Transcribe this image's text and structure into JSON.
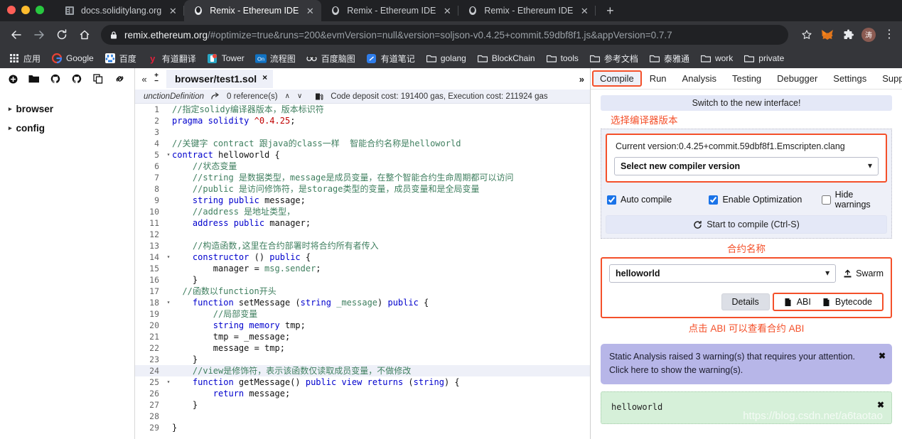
{
  "browser": {
    "tabs": [
      {
        "title": "docs.soliditylang.org",
        "favicon": "book-icon",
        "active": false
      },
      {
        "title": "Remix - Ethereum IDE",
        "favicon": "remix-logo-icon",
        "active": true
      },
      {
        "title": "Remix - Ethereum IDE",
        "favicon": "remix-logo-icon",
        "active": false
      },
      {
        "title": "Remix - Ethereum IDE",
        "favicon": "remix-logo-icon",
        "active": false
      }
    ],
    "new_tab_label": "+",
    "nav": {
      "back": "back-icon",
      "forward": "forward-icon",
      "reload": "reload-icon",
      "home": "home-icon"
    },
    "omnibox": {
      "lock": "lock-icon",
      "domain": "remix.ethereum.org",
      "path": "/#optimize=true&runs=200&evmVersion=null&version=soljson-v0.4.25+commit.59dbf8f1.js&appVersion=0.7.7",
      "star": "star-icon"
    },
    "extensions": [
      {
        "name": "metamask-icon",
        "glyph": "🦊"
      },
      {
        "name": "puzzle-extension-icon",
        "glyph": "🧩"
      },
      {
        "name": "profile-avatar",
        "glyph": "涛"
      },
      {
        "name": "menu-kebab-icon",
        "glyph": "⋮"
      }
    ],
    "bookmarks": [
      {
        "label": "应用",
        "icon": "apps-grid-icon"
      },
      {
        "label": "Google",
        "icon": "google-icon"
      },
      {
        "label": "百度",
        "icon": "baidu-icon"
      },
      {
        "label": "有道翻译",
        "icon": "youdao-translate-icon"
      },
      {
        "label": "Tower",
        "icon": "tower-icon"
      },
      {
        "label": "流程图",
        "icon": "on-flowchart-icon"
      },
      {
        "label": "百度脑图",
        "icon": "baidu-naotu-icon"
      },
      {
        "label": "有道笔记",
        "icon": "youdao-note-icon"
      },
      {
        "label": "golang",
        "icon": "folder-icon"
      },
      {
        "label": "BlockChain",
        "icon": "folder-icon"
      },
      {
        "label": "tools",
        "icon": "folder-icon"
      },
      {
        "label": "参考文档",
        "icon": "folder-icon"
      },
      {
        "label": "泰雅通",
        "icon": "folder-icon"
      },
      {
        "label": "work",
        "icon": "folder-icon"
      },
      {
        "label": "private",
        "icon": "folder-icon"
      }
    ]
  },
  "file_panel": {
    "toolbar_icons": [
      "create-new-file-icon",
      "open-folder-icon",
      "connect-github-icon",
      "publish-gist-icon",
      "copy-files-icon",
      "link-icon"
    ],
    "nodes": [
      {
        "label": "browser",
        "caret": "▸"
      },
      {
        "label": "config",
        "caret": "▸"
      }
    ]
  },
  "editor": {
    "collapse_icon": "collapse-left-icon",
    "zoom_in": "+",
    "zoom_out": "−",
    "tab_label": "browser/test1.sol",
    "tab_close": "×",
    "expand_icon": "»",
    "info": {
      "symbol": "unctionDefinition",
      "goto_icon": "goto-reference-icon",
      "references": "0 reference(s)",
      "up": "∧",
      "down": "∨",
      "gas_icon": "gas-pump-icon",
      "gas_text": "Code deposit cost: 191400 gas, Execution cost: 211924 gas"
    },
    "lines": [
      {
        "n": 1,
        "fold": "",
        "indent": 0,
        "hl": false,
        "tokens": [
          {
            "t": "//指定solidy编译器版本，版本标识符",
            "c": "cmt"
          }
        ]
      },
      {
        "n": 2,
        "fold": "",
        "indent": 0,
        "hl": false,
        "tokens": [
          {
            "t": "pragma",
            "c": "kw"
          },
          {
            "t": " ",
            "c": "src"
          },
          {
            "t": "solidity",
            "c": "kw"
          },
          {
            "t": " ",
            "c": "src"
          },
          {
            "t": "^0.4.25",
            "c": "num"
          },
          {
            "t": ";",
            "c": "src"
          }
        ]
      },
      {
        "n": 3,
        "fold": "",
        "indent": 0,
        "hl": false,
        "tokens": []
      },
      {
        "n": 4,
        "fold": "",
        "indent": 0,
        "hl": false,
        "tokens": [
          {
            "t": "//关键字 contract 跟java的class一样  智能合约名称是helloworld",
            "c": "cmt"
          }
        ]
      },
      {
        "n": 5,
        "fold": "▾",
        "indent": 0,
        "hl": false,
        "tokens": [
          {
            "t": "contract",
            "c": "kw"
          },
          {
            "t": " helloworld {",
            "c": "src"
          }
        ]
      },
      {
        "n": 6,
        "fold": "",
        "indent": 1,
        "hl": false,
        "tokens": [
          {
            "t": "//状态变量",
            "c": "cmt"
          }
        ]
      },
      {
        "n": 7,
        "fold": "",
        "indent": 1,
        "hl": false,
        "tokens": [
          {
            "t": "//string 是数据类型，message是成员变量，在整个智能合约生命周期都可以访问",
            "c": "cmt"
          }
        ]
      },
      {
        "n": 8,
        "fold": "",
        "indent": 1,
        "hl": false,
        "tokens": [
          {
            "t": "//public 是访问修饰符，是storage类型的变量，成员变量和是全局变量",
            "c": "cmt"
          }
        ]
      },
      {
        "n": 9,
        "fold": "",
        "indent": 1,
        "hl": false,
        "tokens": [
          {
            "t": "string",
            "c": "kw"
          },
          {
            "t": " ",
            "c": "src"
          },
          {
            "t": "public",
            "c": "kw"
          },
          {
            "t": " message;",
            "c": "src"
          }
        ]
      },
      {
        "n": 10,
        "fold": "",
        "indent": 1,
        "hl": false,
        "tokens": [
          {
            "t": "//address 是地址类型，",
            "c": "cmt"
          }
        ]
      },
      {
        "n": 11,
        "fold": "",
        "indent": 1,
        "hl": false,
        "tokens": [
          {
            "t": "address",
            "c": "kw"
          },
          {
            "t": " ",
            "c": "src"
          },
          {
            "t": "public",
            "c": "kw"
          },
          {
            "t": " manager;",
            "c": "src"
          }
        ]
      },
      {
        "n": 12,
        "fold": "",
        "indent": 0,
        "hl": false,
        "tokens": []
      },
      {
        "n": 13,
        "fold": "",
        "indent": 1,
        "hl": false,
        "tokens": [
          {
            "t": "//构造函数,这里在合约部署时将合约所有者传入",
            "c": "cmt"
          }
        ]
      },
      {
        "n": 14,
        "fold": "▾",
        "indent": 1,
        "hl": false,
        "tokens": [
          {
            "t": "constructor",
            "c": "kw"
          },
          {
            "t": " () ",
            "c": "src"
          },
          {
            "t": "public",
            "c": "kw"
          },
          {
            "t": " {",
            "c": "src"
          }
        ]
      },
      {
        "n": 15,
        "fold": "",
        "indent": 2,
        "hl": false,
        "tokens": [
          {
            "t": "manager = ",
            "c": "src"
          },
          {
            "t": "msg.sender",
            "c": "cmt"
          },
          {
            "t": ";",
            "c": "src"
          }
        ]
      },
      {
        "n": 16,
        "fold": "",
        "indent": 1,
        "hl": false,
        "tokens": [
          {
            "t": "}",
            "c": "src"
          }
        ]
      },
      {
        "n": 17,
        "fold": "",
        "indent": 0,
        "hl": false,
        "tokens": [
          {
            "t": "  //函数以function开头",
            "c": "cmt"
          }
        ]
      },
      {
        "n": 18,
        "fold": "▾",
        "indent": 1,
        "hl": false,
        "tokens": [
          {
            "t": "function",
            "c": "kw"
          },
          {
            "t": " setMessage (",
            "c": "src"
          },
          {
            "t": "string",
            "c": "kw"
          },
          {
            "t": " ",
            "c": "src"
          },
          {
            "t": "_message",
            "c": "cmt"
          },
          {
            "t": ") ",
            "c": "src"
          },
          {
            "t": "public",
            "c": "kw"
          },
          {
            "t": " {",
            "c": "src"
          }
        ]
      },
      {
        "n": 19,
        "fold": "",
        "indent": 2,
        "hl": false,
        "tokens": [
          {
            "t": "//局部变量",
            "c": "cmt"
          }
        ]
      },
      {
        "n": 20,
        "fold": "",
        "indent": 2,
        "hl": false,
        "tokens": [
          {
            "t": "string",
            "c": "kw"
          },
          {
            "t": " ",
            "c": "src"
          },
          {
            "t": "memory",
            "c": "kw"
          },
          {
            "t": " tmp;",
            "c": "src"
          }
        ]
      },
      {
        "n": 21,
        "fold": "",
        "indent": 2,
        "hl": false,
        "tokens": [
          {
            "t": "tmp = _message;",
            "c": "src"
          }
        ]
      },
      {
        "n": 22,
        "fold": "",
        "indent": 2,
        "hl": false,
        "tokens": [
          {
            "t": "message = tmp;",
            "c": "src"
          }
        ]
      },
      {
        "n": 23,
        "fold": "",
        "indent": 1,
        "hl": false,
        "tokens": [
          {
            "t": "}",
            "c": "src"
          }
        ]
      },
      {
        "n": 24,
        "fold": "",
        "indent": 1,
        "hl": true,
        "tokens": [
          {
            "t": "//view是修饰符，表示该函数仅读取成员变量，不做修改",
            "c": "cmt"
          }
        ]
      },
      {
        "n": 25,
        "fold": "▾",
        "indent": 1,
        "hl": false,
        "tokens": [
          {
            "t": "function",
            "c": "kw"
          },
          {
            "t": " getMessage() ",
            "c": "src"
          },
          {
            "t": "public",
            "c": "kw"
          },
          {
            "t": " ",
            "c": "src"
          },
          {
            "t": "view",
            "c": "kw"
          },
          {
            "t": " ",
            "c": "src"
          },
          {
            "t": "returns",
            "c": "kw"
          },
          {
            "t": " (",
            "c": "src"
          },
          {
            "t": "string",
            "c": "kw"
          },
          {
            "t": ") {",
            "c": "src"
          }
        ]
      },
      {
        "n": 26,
        "fold": "",
        "indent": 2,
        "hl": false,
        "tokens": [
          {
            "t": "return",
            "c": "kw"
          },
          {
            "t": " message;",
            "c": "src"
          }
        ]
      },
      {
        "n": 27,
        "fold": "",
        "indent": 1,
        "hl": false,
        "tokens": [
          {
            "t": "}",
            "c": "src"
          }
        ]
      },
      {
        "n": 28,
        "fold": "",
        "indent": 0,
        "hl": false,
        "tokens": []
      },
      {
        "n": 29,
        "fold": "",
        "indent": 0,
        "hl": false,
        "tokens": [
          {
            "t": "}",
            "c": "src"
          }
        ]
      }
    ]
  },
  "right_panel": {
    "tabs": [
      {
        "label": "Compile",
        "active": true
      },
      {
        "label": "Run",
        "active": false
      },
      {
        "label": "Analysis",
        "active": false
      },
      {
        "label": "Testing",
        "active": false
      },
      {
        "label": "Debugger",
        "active": false
      },
      {
        "label": "Settings",
        "active": false
      },
      {
        "label": "Support",
        "active": false
      }
    ],
    "switch_banner": "Switch to the new interface!",
    "annotation_version": "选择编译器版本",
    "current_version": "Current version:0.4.25+commit.59dbf8f1.Emscripten.clang",
    "version_select": "Select new compiler version",
    "checkboxes": [
      {
        "label": "Auto compile",
        "checked": true
      },
      {
        "label": "Enable Optimization",
        "checked": true
      },
      {
        "label": "Hide warnings",
        "checked": false
      }
    ],
    "compile_button": "Start to compile (Ctrl-S)",
    "compile_button_icon": "refresh-icon",
    "annotation_contract": "合约名称",
    "contract_name": "helloworld",
    "swarm_label": "Swarm",
    "swarm_icon": "upload-icon",
    "details_button": "Details",
    "abi_button": "ABI",
    "bytecode_button": "Bytecode",
    "copy_icon": "copy-icon",
    "annotation_abi": "点击 ABI 可以查看合约 ABI",
    "warning_message": "Static Analysis raised 3 warning(s) that requires your attention. Click here to show the warning(s).",
    "warning_close": "✖",
    "result_contract": "helloworld",
    "result_close": "✖",
    "watermark": "https://blog.csdn.net/a6taotao"
  },
  "colors": {
    "accent_red": "#f4502a",
    "chrome_bg": "#202124",
    "chrome_tab_active": "#35363a",
    "panel_blue": "#eef0f8",
    "warning_purple": "#b7b6e8",
    "success_green": "#d6f0d9",
    "checkbox_blue": "#1a73e8"
  }
}
